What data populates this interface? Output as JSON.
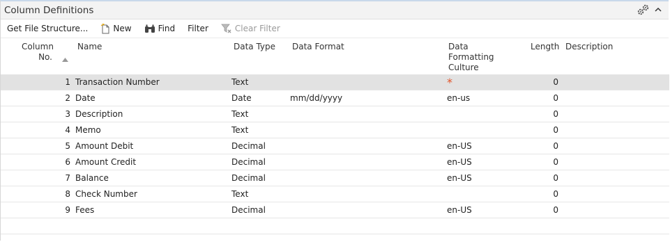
{
  "panel": {
    "title": "Column Definitions",
    "collapse_glyph": "^"
  },
  "toolbar": {
    "get_file_structure": "Get File Structure...",
    "new": "New",
    "find": "Find",
    "filter": "Filter",
    "clear_filter": "Clear Filter"
  },
  "columns": {
    "col_no": "Column No.",
    "name": "Name",
    "data_type": "Data Type",
    "data_format": "Data Format",
    "culture": "Data Formatting Culture",
    "length": "Length",
    "description": "Description"
  },
  "rows": [
    {
      "no": "1",
      "name": "Transaction Number",
      "type": "Text",
      "format": "",
      "culture": "*",
      "length": "0",
      "description": ""
    },
    {
      "no": "2",
      "name": "Date",
      "type": "Date",
      "format": "mm/dd/yyyy",
      "culture": "en-us",
      "length": "0",
      "description": ""
    },
    {
      "no": "3",
      "name": "Description",
      "type": "Text",
      "format": "",
      "culture": "",
      "length": "0",
      "description": ""
    },
    {
      "no": "4",
      "name": "Memo",
      "type": "Text",
      "format": "",
      "culture": "",
      "length": "0",
      "description": ""
    },
    {
      "no": "5",
      "name": "Amount Debit",
      "type": "Decimal",
      "format": "",
      "culture": "en-US",
      "length": "0",
      "description": ""
    },
    {
      "no": "6",
      "name": "Amount Credit",
      "type": "Decimal",
      "format": "",
      "culture": "en-US",
      "length": "0",
      "description": ""
    },
    {
      "no": "7",
      "name": "Balance",
      "type": "Decimal",
      "format": "",
      "culture": "en-US",
      "length": "0",
      "description": ""
    },
    {
      "no": "8",
      "name": "Check Number",
      "type": "Text",
      "format": "",
      "culture": "",
      "length": "0",
      "description": ""
    },
    {
      "no": "9",
      "name": "Fees",
      "type": "Decimal",
      "format": "",
      "culture": "en-US",
      "length": "0",
      "description": ""
    }
  ],
  "colors": {
    "selected_row": "#e2e2e2",
    "required_marker": "#e2542a"
  }
}
